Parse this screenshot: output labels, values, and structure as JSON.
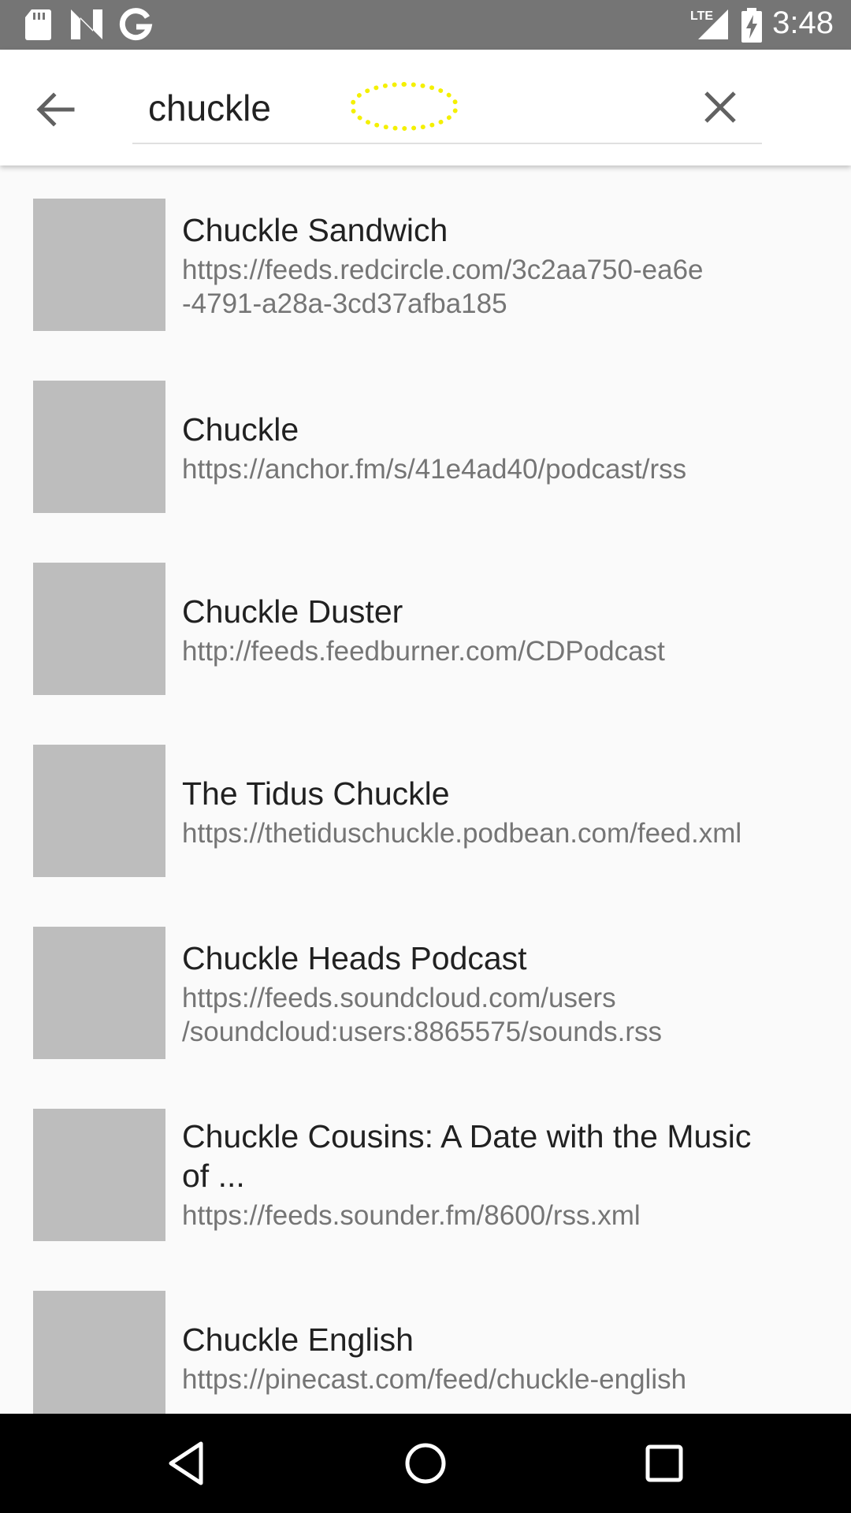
{
  "status_bar": {
    "time": "3:48",
    "network_label": "LTE",
    "icons": [
      "sd-card-icon",
      "n-logo-icon",
      "google-icon",
      "lte-signal-icon",
      "battery-charging-icon"
    ]
  },
  "search": {
    "query": "chuckle"
  },
  "results": [
    {
      "title": "Chuckle Sandwich",
      "url": "https://feeds.redcircle.com/3c2aa750-ea6e\n-4791-a28a-3cd37afba185"
    },
    {
      "title": "Chuckle",
      "url": "https://anchor.fm/s/41e4ad40/podcast/rss"
    },
    {
      "title": "Chuckle Duster",
      "url": "http://feeds.feedburner.com/CDPodcast"
    },
    {
      "title": "The Tidus Chuckle",
      "url": "https://thetiduschuckle.podbean.com/feed.xml"
    },
    {
      "title": "Chuckle Heads Podcast",
      "url": "https://feeds.soundcloud.com/users\n/soundcloud:users:8865575/sounds.rss"
    },
    {
      "title": "Chuckle Cousins: A Date with the Music\nof ...",
      "url": "https://feeds.sounder.fm/8600/rss.xml"
    },
    {
      "title": "Chuckle English",
      "url": "https://pinecast.com/feed/chuckle-english"
    }
  ],
  "colors": {
    "status_bar_bg": "#757575",
    "app_bar_bg": "#ffffff",
    "thumbnail_placeholder": "#bdbdbd",
    "title_text": "#212121",
    "url_text": "#757575",
    "cursor_highlight": "#f4f000"
  }
}
